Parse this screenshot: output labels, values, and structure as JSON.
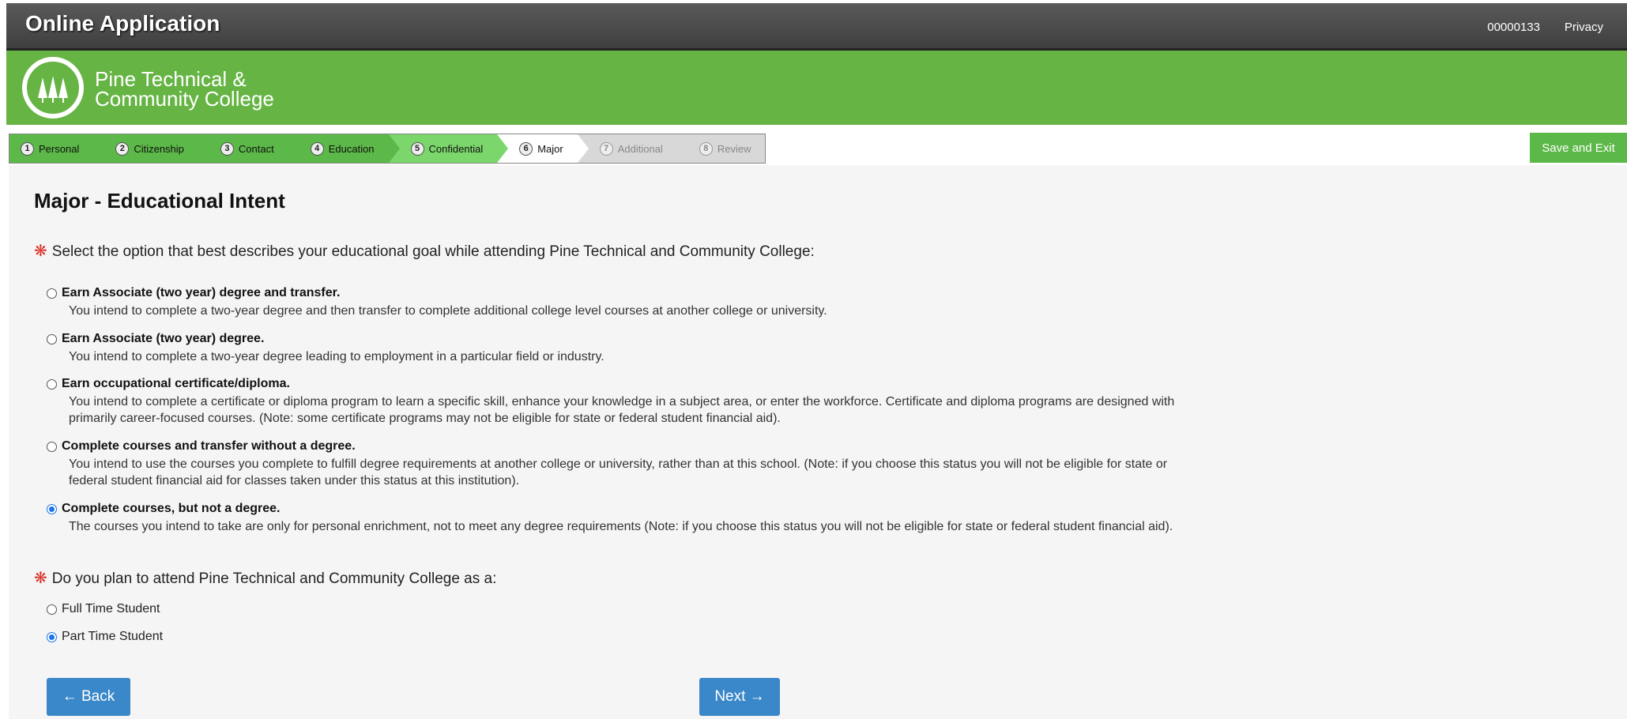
{
  "header": {
    "title": "Online Application",
    "app_id": "00000133",
    "privacy": "Privacy"
  },
  "brand": {
    "line1": "Pine Technical &",
    "line2": "Community College",
    "green": "#66b444"
  },
  "steps": [
    {
      "num": "1",
      "label": "Personal",
      "state": "done"
    },
    {
      "num": "2",
      "label": "Citizenship",
      "state": "done"
    },
    {
      "num": "3",
      "label": "Contact",
      "state": "done"
    },
    {
      "num": "4",
      "label": "Education",
      "state": "done"
    },
    {
      "num": "5",
      "label": "Confidential",
      "state": "done-light"
    },
    {
      "num": "6",
      "label": "Major",
      "state": "active"
    },
    {
      "num": "7",
      "label": "Additional",
      "state": "todo"
    },
    {
      "num": "8",
      "label": "Review",
      "state": "todo"
    }
  ],
  "save_exit": "Save and Exit",
  "page_title": "Major - Educational Intent",
  "q1": {
    "required": "❋",
    "text": "Select the option that best describes your educational goal while attending Pine Technical and Community College:",
    "options": [
      {
        "label": "Earn Associate (two year) degree and transfer.",
        "desc": "You intend to complete a two-year degree and then transfer to complete additional college level courses at another college or university.",
        "checked": false
      },
      {
        "label": "Earn Associate (two year) degree.",
        "desc": "You intend to complete a two-year degree leading to employment in a particular field or industry.",
        "checked": false
      },
      {
        "label": "Earn occupational certificate/diploma.",
        "desc1": "You intend to complete a certificate or diploma program to learn a specific skill, enhance your knowledge in a subject area, or enter the workforce. Certificate and diploma programs are designed with",
        "desc2": "primarily career-focused courses. (Note: some certificate programs may not be eligible for state or federal student financial aid).",
        "checked": false
      },
      {
        "label": "Complete courses and transfer without a degree.",
        "desc1": "You intend to use the courses you complete to fulfill degree requirements at another college or university, rather than at this school. (Note: if you choose this status you will not be eligible for state or",
        "desc2": "federal student financial aid for classes taken under this status at this institution).",
        "checked": false
      },
      {
        "label": "Complete courses, but not a degree.",
        "desc": "The courses you intend to take are only for personal enrichment, not to meet any degree requirements (Note: if you choose this status you will not be eligible for state or federal student financial aid).",
        "checked": true
      }
    ]
  },
  "q2": {
    "required": "❋",
    "text": "Do you plan to attend Pine Technical and Community College as a:",
    "options": [
      {
        "label": "Full Time Student",
        "checked": false
      },
      {
        "label": "Part Time Student",
        "checked": true
      }
    ]
  },
  "nav": {
    "back": "← Back",
    "next": "Next →",
    "button_color": "#3a87c9"
  }
}
